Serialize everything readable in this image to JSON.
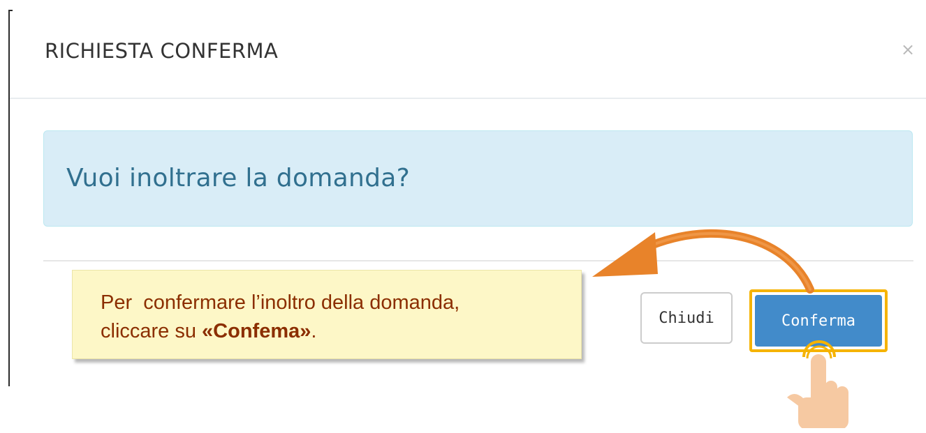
{
  "dialog": {
    "title": "RICHIESTA CONFERMA",
    "close_symbol": "×",
    "message": "Vuoi inoltrare la domanda?",
    "buttons": {
      "close_label": "Chiudi",
      "confirm_label": "Conferma"
    }
  },
  "callout": {
    "line1": "Per  confermare l’inoltro della domanda,",
    "line2_prefix": "cliccare su ",
    "line2_bold": "«Confema»",
    "line2_suffix": "."
  },
  "icons": {
    "close": "close-icon",
    "arrow": "curved-arrow-icon",
    "hand": "pointing-hand-icon"
  },
  "colors": {
    "primary_button": "#428bca",
    "alert_background": "#d9edf7",
    "alert_text": "#31708f",
    "highlight_border": "#f5b301",
    "callout_background": "#fdf7c7",
    "callout_text": "#8b2e00",
    "arrow": "#e8832a",
    "hand_skin": "#f6c9a2"
  }
}
